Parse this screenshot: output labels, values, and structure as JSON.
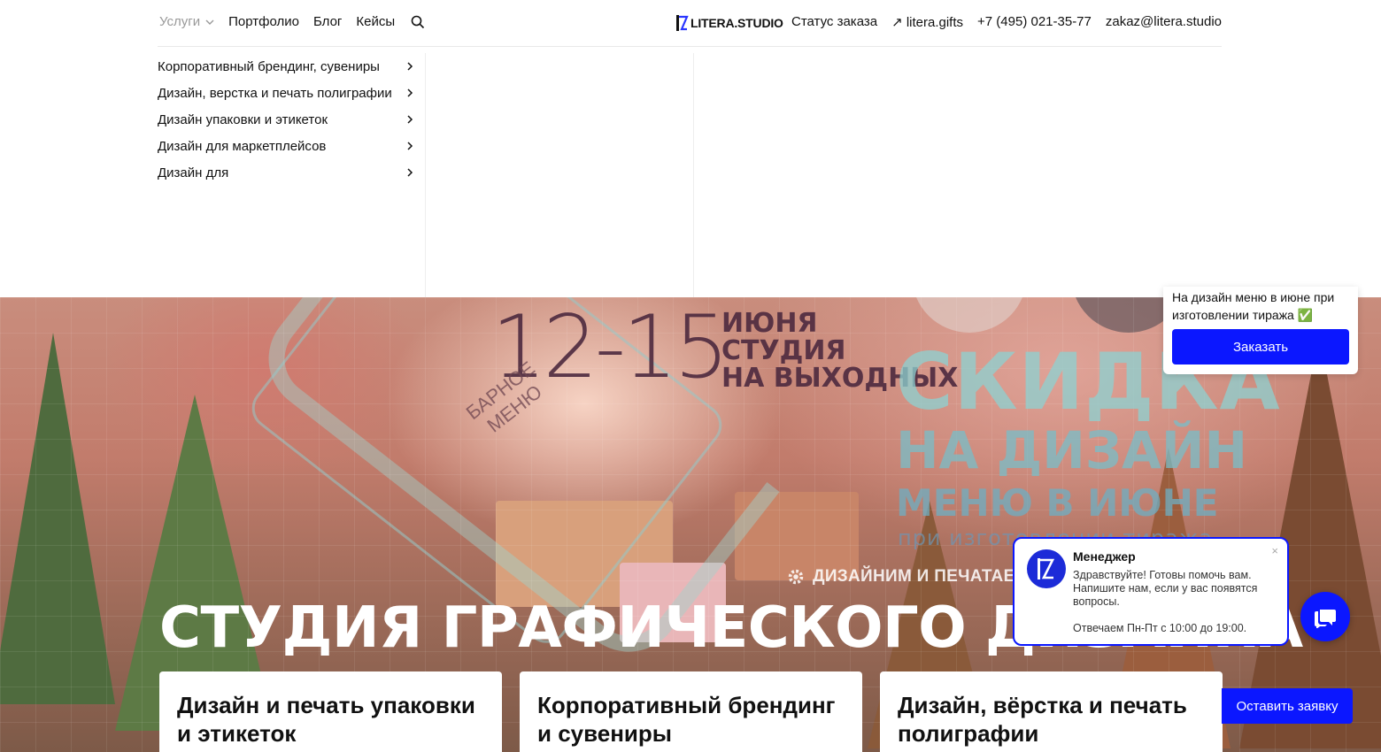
{
  "header": {
    "nav_left": {
      "services": "Услуги",
      "portfolio": "Портфолио",
      "blog": "Блог",
      "cases": "Кейсы"
    },
    "logo": "LITERA.STUDIO",
    "nav_right": {
      "order_status": "Статус заказа",
      "gifts": "↗ litera.gifts",
      "phone": "+7 (495) 021-35-77",
      "email": "zakaz@litera.studio"
    }
  },
  "mega_menu": {
    "items": [
      "Корпоративный брендинг, сувениры",
      "Дизайн, верстка и печать полиграфии",
      "Дизайн упаковки и этикеток",
      "Дизайн для маркетплейсов",
      "Дизайн для"
    ]
  },
  "hero": {
    "promo_date": "12-15",
    "promo_date_lines": [
      "ИЮНЯ",
      "СТУДИЯ",
      "НА ВЫХОДНЫХ"
    ],
    "bar_menu_label": [
      "БАРНОЕ",
      "МЕНЮ"
    ],
    "promo_big": "СКИДКА",
    "promo_mid": "НА ДИЗАЙН",
    "promo_mid2": "МЕНЮ В ИЮНЕ",
    "promo_small": "при изготовлении тиража",
    "tagline": "ДИЗАЙНИМ И ПЕЧАТАЕМ Н",
    "title": "СТУДИЯ ГРАФИЧЕСКОГО ДИЗАЙНА",
    "cards": [
      "Дизайн и печать упаковки и этикеток",
      "Корпоративный брендинг и сувениры",
      "Дизайн, вёрстка и печать полиграфии"
    ],
    "leave_request": "Оставить заявку"
  },
  "order_popup": {
    "text": "На дизайн меню в июне при изготовлении тиража ✅",
    "button": "Заказать"
  },
  "chat": {
    "name": "Менеджер",
    "message": "Здравствуйте! Готовы помочь вам. Напишите нам, если у вас появятся вопросы.",
    "hours": "Отвечаем Пн-Пт с 10:00 до 19:00.",
    "close": "×"
  },
  "colors": {
    "accent": "#0b17ff",
    "text": "#111111",
    "muted": "#999999"
  }
}
